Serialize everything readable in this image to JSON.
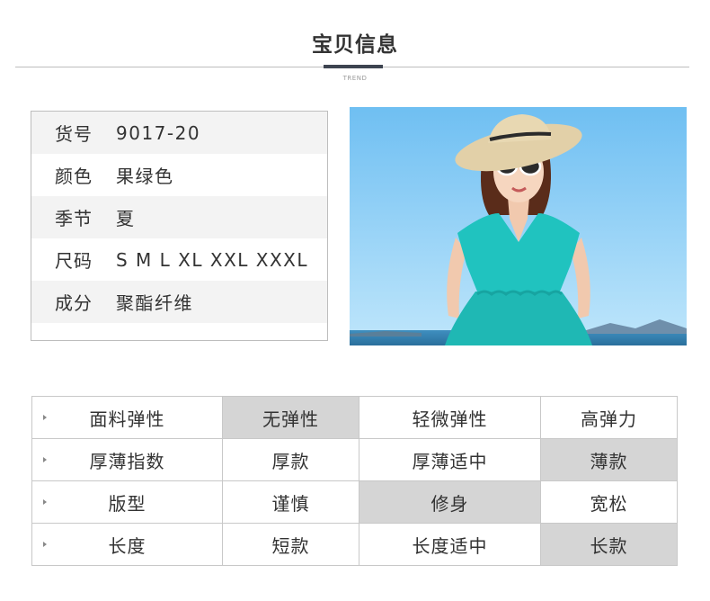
{
  "header": {
    "title": "宝贝信息",
    "subtitle": "TREND"
  },
  "info": [
    {
      "key": "货号",
      "value": "9017-20"
    },
    {
      "key": "颜色",
      "value": "果绿色"
    },
    {
      "key": "季节",
      "value": "夏"
    },
    {
      "key": "尺码",
      "value": "S M L XL XXL XXXL"
    },
    {
      "key": "成分",
      "value": "聚酯纤维"
    }
  ],
  "attributes": [
    {
      "name": "面料弹性",
      "options": [
        "无弹性",
        "轻微弹性",
        "高弹力"
      ],
      "selected_index": 0
    },
    {
      "name": "厚薄指数",
      "options": [
        "厚款",
        "厚薄适中",
        "薄款"
      ],
      "selected_index": 2
    },
    {
      "name": "版型",
      "options": [
        "谨慎",
        "修身",
        "宽松"
      ],
      "selected_index": 1
    },
    {
      "name": "长度",
      "options": [
        "短款",
        "长度适中",
        "长款"
      ],
      "selected_index": 2
    }
  ],
  "colors": {
    "highlight": "#d5d5d5",
    "accent": "#3d4450",
    "dress": "#20c3bf",
    "sky": "#8fd0f5"
  }
}
